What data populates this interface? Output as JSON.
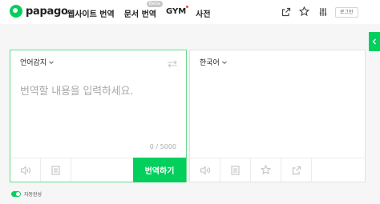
{
  "brand": {
    "name": "papago",
    "color": "#03cf5d"
  },
  "nav": {
    "website_translate": "웹사이트 번역",
    "doc_translate": "문서 번역",
    "doc_badge": "Beta",
    "gym": "GYM",
    "dictionary": "사전"
  },
  "top_icons": [
    "share-icon",
    "star-icon",
    "settings-sliders-icon"
  ],
  "login_label": "로그인",
  "source": {
    "language": "언어감지",
    "placeholder": "번역할 내용을 입력하세요.",
    "counter": "0 / 5000",
    "translate_button": "번역하기"
  },
  "target": {
    "language": "한국어"
  },
  "auto_complete": {
    "label": "자동완성",
    "enabled": true
  }
}
